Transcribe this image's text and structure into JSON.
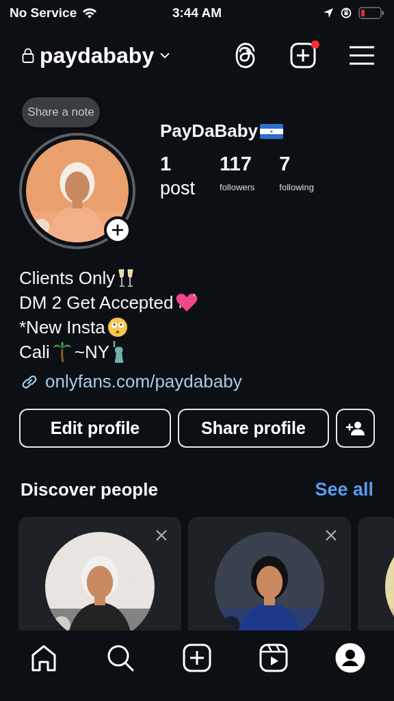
{
  "status_bar": {
    "carrier": "No Service",
    "time": "3:44 AM"
  },
  "header": {
    "username": "paydababy",
    "new_post_badge": true
  },
  "profile": {
    "note": "Share a note",
    "display_name": "PayDaBaby",
    "stats": [
      {
        "count": "1",
        "label": "post"
      },
      {
        "count": "117",
        "label": "followers"
      },
      {
        "count": "7",
        "label": "following"
      }
    ],
    "bio": [
      "Clients Only",
      "DM 2 Get Accepted",
      "*New Insta",
      "Cali",
      "~NY"
    ],
    "link": "onlyfans.com/paydababy",
    "buttons": [
      "Edit profile",
      "Share profile"
    ]
  },
  "discover": {
    "title": "Discover people",
    "see_all": "See all"
  },
  "tab_bar": [
    {
      "selected": false
    },
    {
      "selected": false
    },
    {
      "selected": false
    },
    {
      "selected": false
    },
    {
      "selected": true
    }
  ]
}
